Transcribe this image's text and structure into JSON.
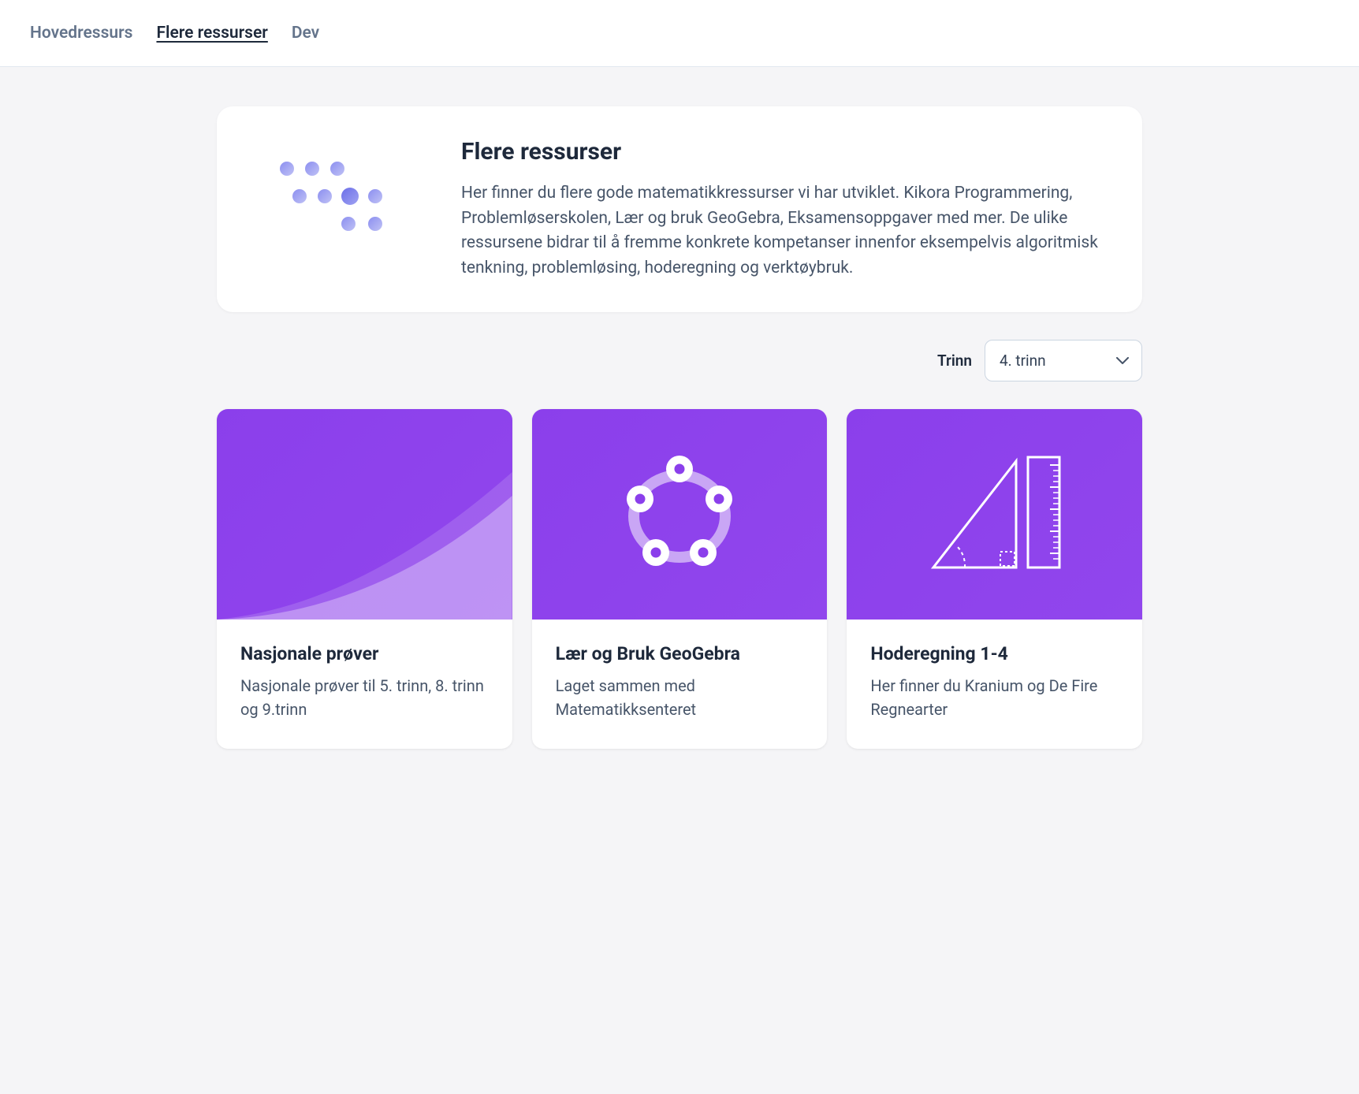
{
  "nav": {
    "items": [
      {
        "label": "Hovedressurs",
        "active": false
      },
      {
        "label": "Flere ressurser",
        "active": true
      },
      {
        "label": "Dev",
        "active": false
      }
    ]
  },
  "header": {
    "title": "Flere ressurser",
    "description": "Her finner du flere gode matematikkressurser vi har utviklet. Kikora Programmering, Problemløserskolen, Lær og bruk GeoGebra, Eksamensoppgaver med mer. De ulike ressursene bidrar til å fremme konkrete kompetanser innenfor eksempelvis algoritmisk tenkning, problemløsing, hoderegning og verktøybruk."
  },
  "filter": {
    "label": "Trinn",
    "selected": "4. trinn"
  },
  "cards": [
    {
      "title": "Nasjonale prøver",
      "description": "Nasjonale prøver til 5. trinn, 8. trinn og 9.trinn"
    },
    {
      "title": "Lær og Bruk GeoGebra",
      "description": "Laget sammen med Matematikksenteret"
    },
    {
      "title": "Hoderegning 1-4",
      "description": "Her finner du Kranium og De Fire Regnearter"
    }
  ]
}
